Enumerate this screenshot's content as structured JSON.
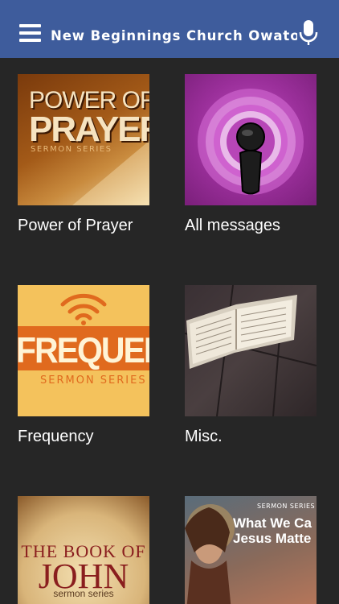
{
  "header": {
    "title": "New Beginnings Church Owatonna",
    "background": "#3e5c9c"
  },
  "grid": {
    "items": [
      {
        "label": "Power of Prayer",
        "art": {
          "line1": "POWER OF",
          "line2": "PRAYER",
          "line3": "SERMON SERIES"
        }
      },
      {
        "label": "All messages",
        "art": {
          "icon": "podcast-icon"
        }
      },
      {
        "label": "Frequency",
        "art": {
          "word": "FREQUENCY",
          "sub": "SERMON SERIES",
          "icon": "wifi-icon"
        }
      },
      {
        "label": "Misc.",
        "art": {
          "icon": "open-bible-icon"
        }
      },
      {
        "label": "",
        "art": {
          "line1": "THE BOOK OF",
          "line2": "JOHN",
          "line3": "sermon series"
        }
      },
      {
        "label": "",
        "art": {
          "series": "SERMON SERIES",
          "line1": "What We Ca",
          "line2": "Jesus Matte"
        }
      }
    ]
  }
}
